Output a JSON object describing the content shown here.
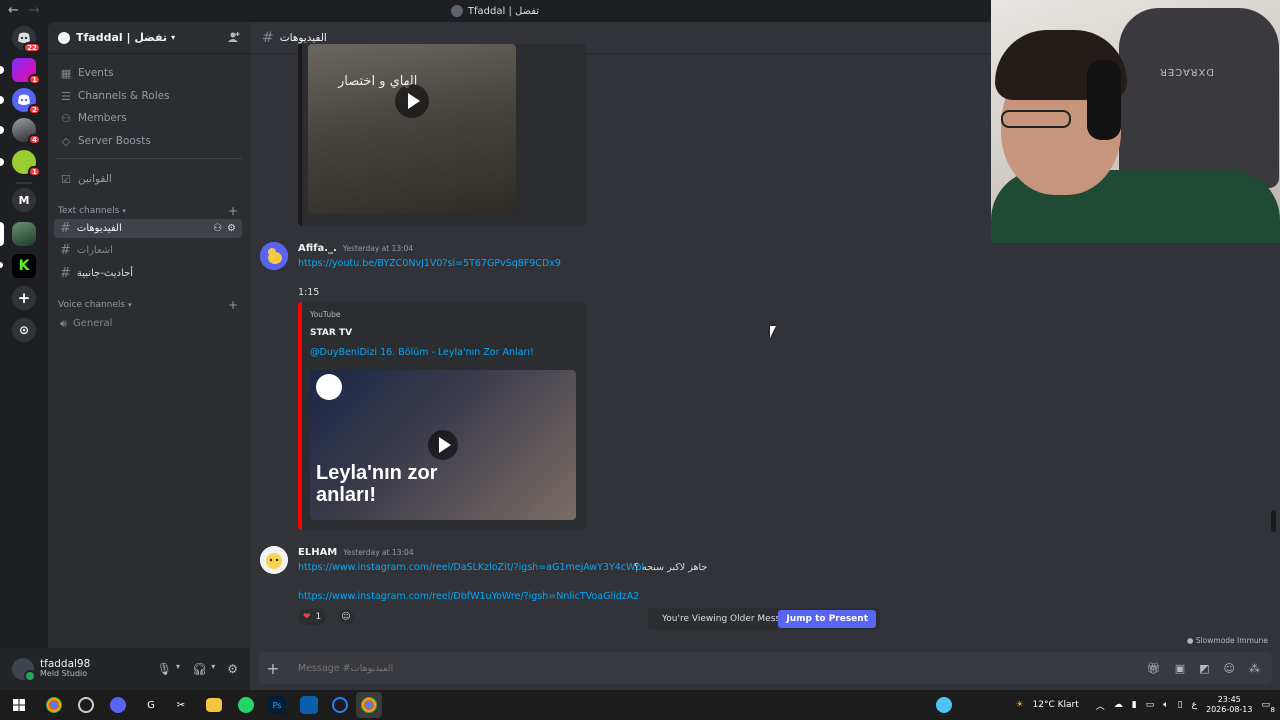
{
  "window": {
    "title": "Tfaddal | تفضل",
    "nav_back": "←",
    "nav_forward": "→"
  },
  "servers": [
    {
      "name": "direct-messages",
      "badge": "22"
    },
    {
      "name": "server-racing",
      "badge": "1"
    },
    {
      "name": "server-discord",
      "badge": "2"
    },
    {
      "name": "server-girl",
      "badge": "4"
    },
    {
      "name": "server-green",
      "badge": "1"
    },
    {
      "name": "server-m",
      "letter": "M"
    },
    {
      "name": "server-tfaddal"
    },
    {
      "name": "server-kick",
      "letter": "K"
    },
    {
      "name": "add-server",
      "letter": "+"
    },
    {
      "name": "discover",
      "letter": "⊙"
    }
  ],
  "sidebar": {
    "server_name": "Tfaddal | تفضل",
    "nav": [
      {
        "label": "Events",
        "icon": "calendar-icon"
      },
      {
        "label": "Channels & Roles",
        "icon": "list-icon"
      },
      {
        "label": "Members",
        "icon": "members-icon"
      },
      {
        "label": "Server Boosts",
        "icon": "boost-icon"
      }
    ],
    "rules_channel": "القوانين",
    "text_category": "Text channels",
    "text_channels": [
      {
        "label": "الفيديوهات",
        "active": true
      },
      {
        "label": "اشعارات",
        "active": false
      },
      {
        "label": "أحاديث-جانبية",
        "active": false
      }
    ],
    "voice_category": "Voice channels",
    "voice_channels": [
      {
        "label": "General"
      }
    ]
  },
  "user": {
    "name": "tfaddal98",
    "status": "Meld Studio"
  },
  "chat": {
    "channel_name": "الفيديوهات",
    "video_caption": "الهاي و اختصار",
    "messages": [
      {
        "author": "Afifa._.",
        "timestamp": "Yesterday at 13:04",
        "link": "https://youtu.be/BYZC0NvJ1V0?si=5T67GPvSq8F9CDx9",
        "extra": "1:15",
        "embed": {
          "provider": "YouTube",
          "author": "STAR TV",
          "title": "@DuyBeniDizi 16. Bölüm - Leyla'nın Zor Anları!",
          "thumbnail_text": "Leyla'nın zor anları!"
        }
      },
      {
        "author": "ELHAM",
        "timestamp": "Yesterday at 13:04",
        "link": "https://www.instagram.com/reel/DaSLKzloZit/?igsh=aG1mejAwY3Y4cWpl",
        "suffix": "جاهز لاكبر سنحه ؟",
        "link2": "https://www.instagram.com/reel/DbfW1uYoWre/?igsh=NnlicTVoaGlidzA2",
        "reactions": [
          {
            "emoji": "❤",
            "count": "1"
          }
        ]
      }
    ],
    "older_notice": "You're Viewing Older Messages",
    "jump_label": "Jump to Present",
    "slowmode": "Slowmode Immune",
    "composer_placeholder": "Message #الفيديوهات"
  },
  "webcam": {
    "chair_brand": "DXRACER"
  },
  "taskbar": {
    "weather": "12°C  Klart",
    "lang": "ع",
    "time": "23:45",
    "date": "2026-08-13",
    "notifications": "8"
  }
}
